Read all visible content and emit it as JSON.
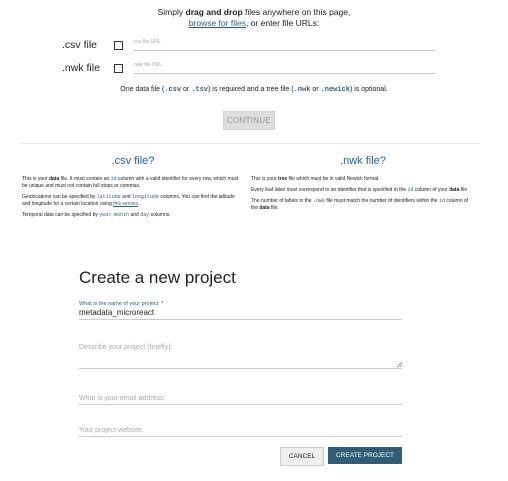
{
  "intro": {
    "line1_pre": "Simply ",
    "line1_bold": "drag and drop",
    "line1_post": " files anywhere on this page,",
    "line2_link": "browse for files",
    "line2_post": ", or enter file URLs:"
  },
  "csv_row": {
    "label": ".csv file",
    "placeholder": "csv file URL"
  },
  "nwk_row": {
    "label": ".nwk file",
    "placeholder": "nwk file URL"
  },
  "note": {
    "pre": "One data file (",
    "csv": ".csv",
    "or1": " or ",
    "tsv": ".tsv",
    "mid": ") is required and a tree file (",
    "nwk": ".nwk",
    "or2": " or ",
    "newick": ".newick",
    "post": ") is optional."
  },
  "continue_label": "CONTINUE",
  "csv_help": {
    "title": ".csv file?",
    "p1_a": "This is your ",
    "p1_b": "data",
    "p1_c": " file. It must contain an ",
    "p1_code": "id",
    "p1_d": " column with a valid identifier for every row, which must be unique and must not contain full stops or commas.",
    "p2_a": "Geolocations can be specified by ",
    "p2_code1": "latitude",
    "p2_b": " and ",
    "p2_code2": "longitude",
    "p2_c": " columns. You can find the latitude and longitude for a certain location using ",
    "p2_link": "this service",
    "p2_d": ".",
    "p3_a": "Temporal data can be specified by ",
    "p3_code1": "year",
    "p3_b": ", ",
    "p3_code2": "month",
    "p3_c": " and ",
    "p3_code3": "day",
    "p3_d": " columns."
  },
  "nwk_help": {
    "title": ".nwk file?",
    "p1_a": "This is your ",
    "p1_b": "tree",
    "p1_c": " file which must be in valid Newick format.",
    "p2_a": "Every leaf label must correspond to an identifier that is specified in the ",
    "p2_code": "id",
    "p2_b": " column of your ",
    "p2_c": "data",
    "p2_d": " file",
    "p3_a": "The number of labels in the ",
    "p3_code1": ".nwk",
    "p3_b": " file must match the number of identifiers within the ",
    "p3_code2": "id",
    "p3_c": " column of the ",
    "p3_d": "data",
    "p3_e": " file."
  },
  "form": {
    "title": "Create a new project",
    "name_label": "What is the name of your project: *",
    "name_value": "metadata_microreact",
    "description_placeholder": "Describe your project (briefly):",
    "email_placeholder": "What is your email address:",
    "website_placeholder": "Your project website:",
    "cancel_label": "CANCEL",
    "create_label": "CREATE PROJECT"
  }
}
